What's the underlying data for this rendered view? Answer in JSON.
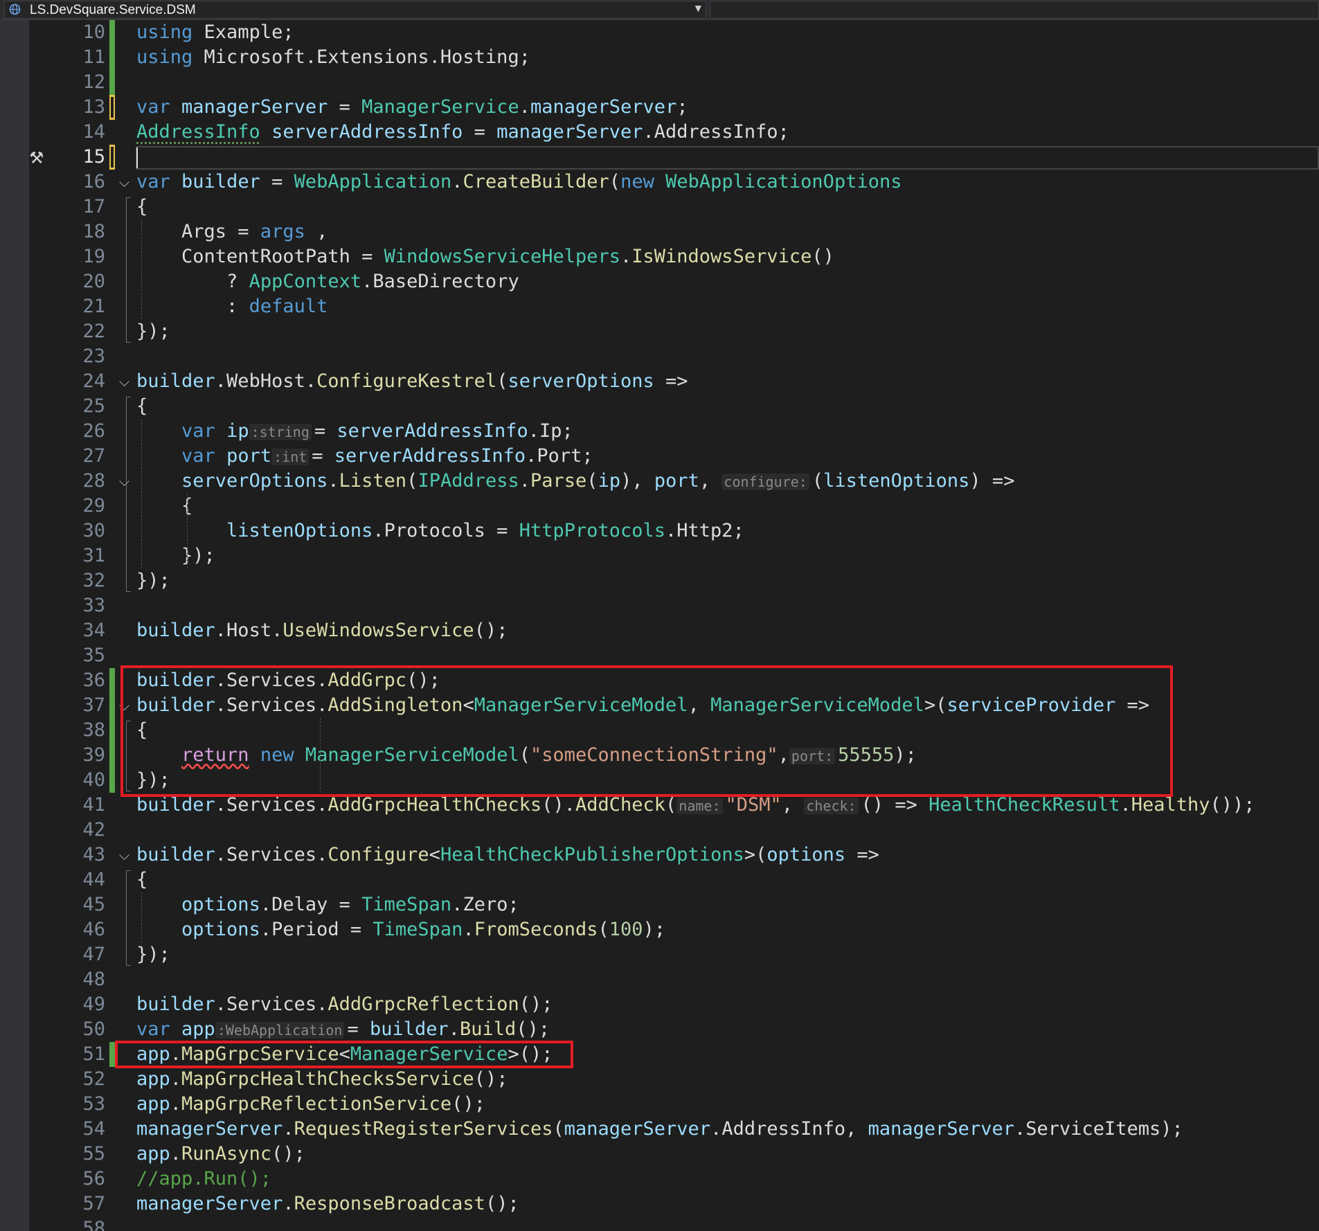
{
  "navbar": {
    "project": "LS.DevSquare.Service.DSM",
    "project_icon": "csharp-project-icon",
    "dropdown_icon": "chevron-down-icon"
  },
  "editor": {
    "margin_icon": "build-hammer-icon",
    "current_line": "15",
    "lines": [
      {
        "n": "10",
        "t": [
          [
            "kw",
            "using"
          ],
          [
            "",
            "Example;"
          ]
        ]
      },
      {
        "n": "11",
        "t": [
          [
            "kw",
            "using"
          ],
          [
            "",
            "Microsoft.Extensions.Hosting;"
          ]
        ]
      },
      {
        "n": "12",
        "t": []
      },
      {
        "n": "13",
        "t": [
          [
            "kw",
            "var"
          ],
          [
            "va",
            "managerServer"
          ],
          [
            "",
            " = "
          ],
          [
            "ty",
            "ManagerService"
          ],
          [
            "",
            "."
          ],
          [
            "va",
            "managerServer"
          ],
          [
            "",
            ";"
          ]
        ]
      },
      {
        "n": "14",
        "t": [
          [
            "ty",
            "AddressInfo"
          ],
          [
            "",
            " "
          ],
          [
            "va",
            "serverAddressInfo"
          ],
          [
            "",
            " = "
          ],
          [
            "va",
            "managerServer"
          ],
          [
            "",
            ".AddressInfo;"
          ]
        ]
      },
      {
        "n": "15",
        "t": []
      },
      {
        "n": "16",
        "t": [
          [
            "kw",
            "var"
          ],
          [
            "va",
            "builder"
          ],
          [
            "",
            " = "
          ],
          [
            "ty",
            "WebApplication"
          ],
          [
            "",
            "."
          ],
          [
            "me",
            "CreateBuilder"
          ],
          [
            "",
            "("
          ],
          [
            "kw",
            "new"
          ],
          [
            "",
            " "
          ],
          [
            "ty",
            "WebApplicationOptions"
          ]
        ]
      },
      {
        "n": "17",
        "t": [
          [
            "",
            "{"
          ]
        ]
      },
      {
        "n": "18",
        "t": [
          [
            "",
            "    Args = "
          ],
          [
            "kw",
            "args"
          ],
          [
            "",
            ","
          ]
        ]
      },
      {
        "n": "19",
        "t": [
          [
            "",
            "    ContentRootPath = "
          ],
          [
            "ty",
            "WindowsServiceHelpers"
          ],
          [
            "",
            "."
          ],
          [
            "me",
            "IsWindowsService"
          ],
          [
            "",
            "()"
          ]
        ]
      },
      {
        "n": "20",
        "t": [
          [
            "",
            "        ? "
          ],
          [
            "ty",
            "AppContext"
          ],
          [
            "",
            ".BaseDirectory"
          ]
        ]
      },
      {
        "n": "21",
        "t": [
          [
            "",
            "        : "
          ],
          [
            "kw",
            "default"
          ]
        ]
      },
      {
        "n": "22",
        "t": [
          [
            "",
            "});"
          ]
        ]
      },
      {
        "n": "23",
        "t": []
      },
      {
        "n": "24",
        "t": [
          [
            "va",
            "builder"
          ],
          [
            "",
            ".WebHost."
          ],
          [
            "me",
            "ConfigureKestrel"
          ],
          [
            "",
            "("
          ],
          [
            "va",
            "serverOptions"
          ],
          [
            "",
            " =>"
          ]
        ]
      },
      {
        "n": "25",
        "t": [
          [
            "",
            "{"
          ]
        ]
      },
      {
        "n": "26",
        "t": [
          [
            "",
            "    "
          ],
          [
            "kw",
            "var"
          ],
          [
            "",
            " "
          ],
          [
            "va",
            "ip"
          ],
          [
            "hint",
            ":string"
          ],
          [
            "",
            "= "
          ],
          [
            "va",
            "serverAddressInfo"
          ],
          [
            "",
            ".Ip;"
          ]
        ]
      },
      {
        "n": "27",
        "t": [
          [
            "",
            "    "
          ],
          [
            "kw",
            "var"
          ],
          [
            "",
            " "
          ],
          [
            "va",
            "port"
          ],
          [
            "hint",
            ":int"
          ],
          [
            "",
            "= "
          ],
          [
            "va",
            "serverAddressInfo"
          ],
          [
            "",
            ".Port;"
          ]
        ]
      },
      {
        "n": "28",
        "t": [
          [
            "",
            "    "
          ],
          [
            "va",
            "serverOptions"
          ],
          [
            "",
            "."
          ],
          [
            "me",
            "Listen"
          ],
          [
            "",
            "("
          ],
          [
            "ty",
            "IPAddress"
          ],
          [
            "",
            "."
          ],
          [
            "me",
            "Parse"
          ],
          [
            "",
            "("
          ],
          [
            "va",
            "ip"
          ],
          [
            "",
            "), "
          ],
          [
            "va",
            "port"
          ],
          [
            "",
            ", "
          ],
          [
            "hint",
            "configure:"
          ],
          [
            "",
            "("
          ],
          [
            "va",
            "listenOptions"
          ],
          [
            "",
            ") =>"
          ]
        ]
      },
      {
        "n": "29",
        "t": [
          [
            "",
            "    {"
          ]
        ]
      },
      {
        "n": "30",
        "t": [
          [
            "",
            "        "
          ],
          [
            "va",
            "listenOptions"
          ],
          [
            "",
            ".Protocols = "
          ],
          [
            "ty",
            "HttpProtocols"
          ],
          [
            "",
            ".Http2;"
          ]
        ]
      },
      {
        "n": "31",
        "t": [
          [
            "",
            "    });"
          ]
        ]
      },
      {
        "n": "32",
        "t": [
          [
            "",
            "});"
          ]
        ]
      },
      {
        "n": "33",
        "t": []
      },
      {
        "n": "34",
        "t": [
          [
            "va",
            "builder"
          ],
          [
            "",
            ".Host."
          ],
          [
            "me",
            "UseWindowsService"
          ],
          [
            "",
            "();"
          ]
        ]
      },
      {
        "n": "35",
        "t": []
      },
      {
        "n": "36",
        "t": [
          [
            "va",
            "builder"
          ],
          [
            "",
            ".Services."
          ],
          [
            "me",
            "AddGrpc"
          ],
          [
            "",
            "();"
          ]
        ]
      },
      {
        "n": "37",
        "t": [
          [
            "va",
            "builder"
          ],
          [
            "",
            ".Services."
          ],
          [
            "me",
            "AddSingleton"
          ],
          [
            "",
            "<"
          ],
          [
            "ty",
            "ManagerServiceModel"
          ],
          [
            "",
            ", "
          ],
          [
            "ty",
            "ManagerServiceModel"
          ],
          [
            "",
            ">("
          ],
          [
            "va",
            "serviceProvider"
          ],
          [
            "",
            " =>"
          ]
        ]
      },
      {
        "n": "38",
        "t": [
          [
            "",
            "{"
          ]
        ]
      },
      {
        "n": "39",
        "t": [
          [
            "",
            "    "
          ],
          [
            "ctl",
            "return"
          ],
          [
            "",
            " "
          ],
          [
            "kw",
            "new"
          ],
          [
            "",
            " "
          ],
          [
            "ty",
            "ManagerServiceModel"
          ],
          [
            "",
            "("
          ],
          [
            "st",
            "\"someConnectionString\""
          ],
          [
            "",
            ","
          ],
          [
            "hint",
            "port:"
          ],
          [
            "nu",
            "55555"
          ],
          [
            "",
            ");"
          ]
        ]
      },
      {
        "n": "40",
        "t": [
          [
            "",
            "});"
          ]
        ]
      },
      {
        "n": "41",
        "t": [
          [
            "va",
            "builder"
          ],
          [
            "",
            ".Services."
          ],
          [
            "me",
            "AddGrpcHealthChecks"
          ],
          [
            "",
            "()."
          ],
          [
            "me",
            "AddCheck"
          ],
          [
            "",
            "("
          ],
          [
            "hint",
            "name:"
          ],
          [
            "st",
            "\"DSM\""
          ],
          [
            "",
            ", "
          ],
          [
            "hint",
            "check:"
          ],
          [
            "",
            "() => "
          ],
          [
            "ty",
            "HealthCheckResult"
          ],
          [
            "",
            "."
          ],
          [
            "me",
            "Healthy"
          ],
          [
            "",
            "());"
          ]
        ]
      },
      {
        "n": "42",
        "t": []
      },
      {
        "n": "43",
        "t": [
          [
            "va",
            "builder"
          ],
          [
            "",
            ".Services."
          ],
          [
            "me",
            "Configure"
          ],
          [
            "",
            "<"
          ],
          [
            "ty",
            "HealthCheckPublisherOptions"
          ],
          [
            "",
            ">("
          ],
          [
            "va",
            "options"
          ],
          [
            "",
            " =>"
          ]
        ]
      },
      {
        "n": "44",
        "t": [
          [
            "",
            "{"
          ]
        ]
      },
      {
        "n": "45",
        "t": [
          [
            "",
            "    "
          ],
          [
            "va",
            "options"
          ],
          [
            "",
            ".Delay = "
          ],
          [
            "ty",
            "TimeSpan"
          ],
          [
            "",
            ".Zero;"
          ]
        ]
      },
      {
        "n": "46",
        "t": [
          [
            "",
            "    "
          ],
          [
            "va",
            "options"
          ],
          [
            "",
            ".Period = "
          ],
          [
            "ty",
            "TimeSpan"
          ],
          [
            "",
            "."
          ],
          [
            "me",
            "FromSeconds"
          ],
          [
            "",
            "("
          ],
          [
            "nu",
            "100"
          ],
          [
            "",
            ");"
          ]
        ]
      },
      {
        "n": "47",
        "t": [
          [
            "",
            "});"
          ]
        ]
      },
      {
        "n": "48",
        "t": []
      },
      {
        "n": "49",
        "t": [
          [
            "va",
            "builder"
          ],
          [
            "",
            ".Services."
          ],
          [
            "me",
            "AddGrpcReflection"
          ],
          [
            "",
            "();"
          ]
        ]
      },
      {
        "n": "50",
        "t": [
          [
            "kw",
            "var"
          ],
          [
            "",
            " "
          ],
          [
            "va",
            "app"
          ],
          [
            "hint",
            ":WebApplication"
          ],
          [
            "",
            "= "
          ],
          [
            "va",
            "builder"
          ],
          [
            "",
            "."
          ],
          [
            "me",
            "Build"
          ],
          [
            "",
            "();"
          ]
        ]
      },
      {
        "n": "51",
        "t": [
          [
            "va",
            "app"
          ],
          [
            "",
            "."
          ],
          [
            "me",
            "MapGrpcService"
          ],
          [
            "",
            "<"
          ],
          [
            "ty",
            "ManagerService"
          ],
          [
            "",
            ">();"
          ]
        ]
      },
      {
        "n": "52",
        "t": [
          [
            "va",
            "app"
          ],
          [
            "",
            "."
          ],
          [
            "me",
            "MapGrpcHealthChecksService"
          ],
          [
            "",
            "();"
          ]
        ]
      },
      {
        "n": "53",
        "t": [
          [
            "va",
            "app"
          ],
          [
            "",
            "."
          ],
          [
            "me",
            "MapGrpcReflectionService"
          ],
          [
            "",
            "();"
          ]
        ]
      },
      {
        "n": "54",
        "t": [
          [
            "va",
            "managerServer"
          ],
          [
            "",
            "."
          ],
          [
            "me",
            "RequestRegisterServices"
          ],
          [
            "",
            "("
          ],
          [
            "va",
            "managerServer"
          ],
          [
            "",
            ".AddressInfo, "
          ],
          [
            "va",
            "managerServer"
          ],
          [
            "",
            ".ServiceItems);"
          ]
        ]
      },
      {
        "n": "55",
        "t": [
          [
            "va",
            "app"
          ],
          [
            "",
            "."
          ],
          [
            "me",
            "RunAsync"
          ],
          [
            "",
            "();"
          ]
        ]
      },
      {
        "n": "56",
        "t": [
          [
            "cm",
            "//app.Run();"
          ]
        ]
      },
      {
        "n": "57",
        "t": [
          [
            "va",
            "managerServer"
          ],
          [
            "",
            "."
          ],
          [
            "me",
            "ResponseBroadcast"
          ],
          [
            "",
            "();"
          ]
        ]
      },
      {
        "n": "58",
        "t": []
      }
    ],
    "highlight_boxes": [
      {
        "label": "addsingleton-block",
        "from_line": "36",
        "to_line": "40"
      },
      {
        "label": "mapgrpcservice-line",
        "from_line": "51",
        "to_line": "51"
      }
    ]
  }
}
